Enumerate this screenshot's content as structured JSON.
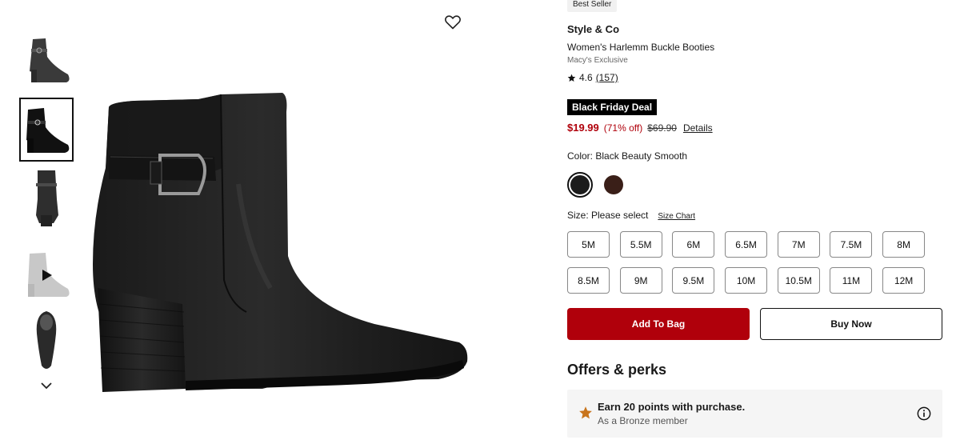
{
  "thumbnails": [
    {
      "view": "side",
      "selected": false
    },
    {
      "view": "side-detail",
      "selected": true
    },
    {
      "view": "back",
      "selected": false
    },
    {
      "view": "video",
      "selected": false
    },
    {
      "view": "top",
      "selected": false
    }
  ],
  "icons": {
    "wishlist": "heart-icon",
    "scroll_down": "chevron-down-icon",
    "play": "play-icon",
    "rating": "star-icon",
    "offer": "star-icon",
    "info": "info-icon"
  },
  "product": {
    "badge": "Best Seller",
    "brand": "Style & Co",
    "name": "Women's Harlemm Buckle Booties",
    "exclusive": "Macy's Exclusive",
    "rating": "4.6",
    "review_count": "(157)",
    "deal_badge": "Black Friday Deal",
    "price": {
      "sale": "$19.99",
      "percent_off": "(71% off)",
      "original": "$69.90",
      "details_link": "Details"
    },
    "color": {
      "label": "Color: Black Beauty Smooth",
      "swatches": [
        {
          "name": "black",
          "hex": "#1c1c1c",
          "selected": true
        },
        {
          "name": "brown",
          "hex": "#3a1f18",
          "selected": false
        }
      ]
    },
    "size": {
      "label": "Size: Please select",
      "chart_link": "Size Chart",
      "options": [
        "5M",
        "5.5M",
        "6M",
        "6.5M",
        "7M",
        "7.5M",
        "8M",
        "8.5M",
        "9M",
        "9.5M",
        "10M",
        "10.5M",
        "11M",
        "12M"
      ]
    }
  },
  "actions": {
    "add_to_bag": "Add To Bag",
    "buy_now": "Buy Now"
  },
  "offers": {
    "title": "Offers & perks",
    "item_main": "Earn 20 points with purchase.",
    "item_sub": "As a Bronze member",
    "star_color": "#c8741c"
  },
  "colors": {
    "accent_red": "#b0000b"
  }
}
